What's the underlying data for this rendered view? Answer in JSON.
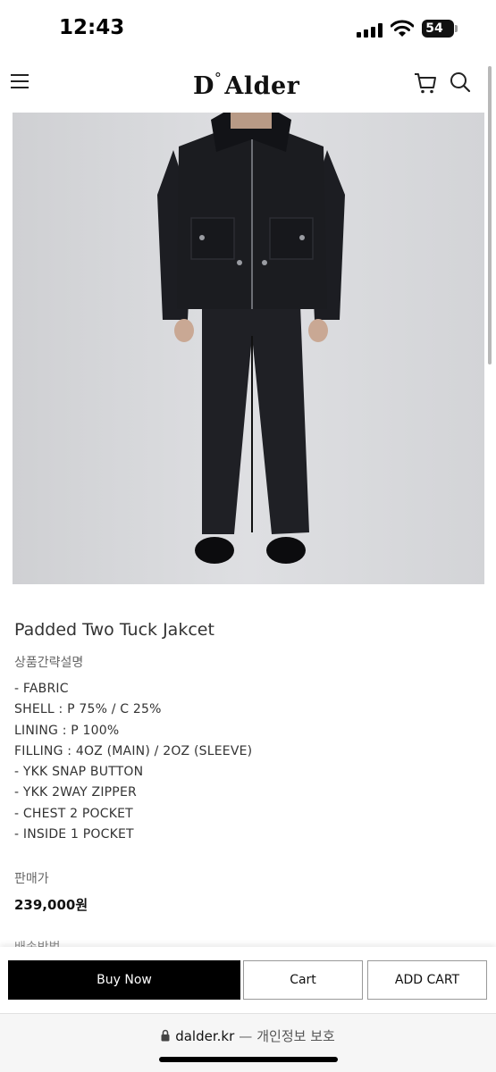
{
  "status_bar": {
    "time": "12:43",
    "battery": "54"
  },
  "header": {
    "logo_mark": "D",
    "logo_degree": "°",
    "logo_text": "Alder",
    "icons": [
      "menu-icon",
      "cart-icon",
      "search-icon"
    ]
  },
  "product": {
    "title": "Padded Two Tuck Jakcet",
    "summary_label": "상품간략설명",
    "specs": [
      "- FABRIC",
      "SHELL : P 75% / C 25%",
      "LINING : P 100%",
      "FILLING : 4OZ (MAIN) / 2OZ (SLEEVE)",
      "- YKK SNAP BUTTON",
      "- YKK 2WAY ZIPPER",
      "- CHEST 2 POCKET",
      "- INSIDE 1 POCKET"
    ],
    "price_label": "판매가",
    "price": "239,000원",
    "shipping_label": "배송방법"
  },
  "actions": {
    "buy_now": "Buy Now",
    "cart": "Cart",
    "add_cart": "ADD CART"
  },
  "browser": {
    "domain": "dalder.kr",
    "separator": "—",
    "privacy": "개인정보 보호"
  },
  "colors": {
    "accent": "#000000",
    "image_background": "#d9dadd",
    "jacket": "#1b1c20"
  }
}
